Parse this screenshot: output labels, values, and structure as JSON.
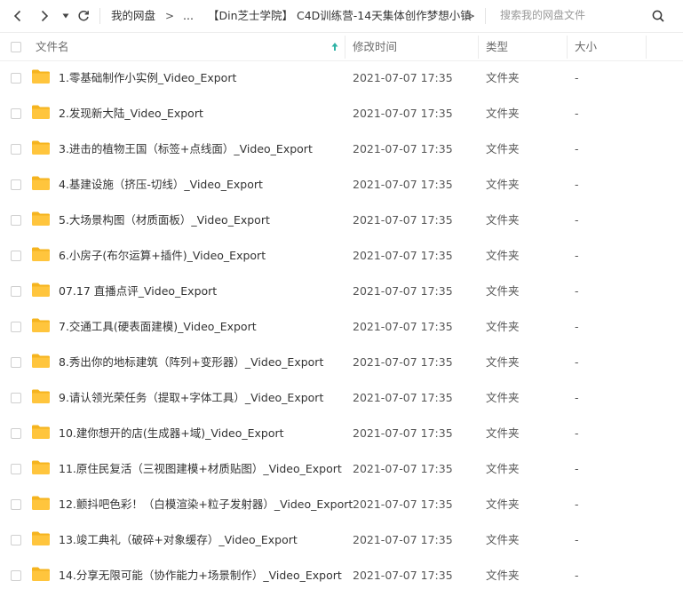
{
  "toolbar": {
    "back_icon": "chevron-left-icon",
    "forward_icon": "chevron-right-icon",
    "history_icon": "caret-down-icon",
    "refresh_icon": "refresh-icon",
    "breadcrumb": {
      "root": "我的网盘",
      "sep1": ">",
      "ellipsis": "...",
      "current": "【Din芝士学院】 C4D训练营-14天集体创作梦想小镇",
      "sep2": ">"
    },
    "search_placeholder": "搜索我的网盘文件",
    "search_icon": "search-icon"
  },
  "columns": {
    "name": "文件名",
    "sort_icon": "sort-ascending-icon",
    "modified": "修改时间",
    "type": "类型",
    "size": "大小"
  },
  "colors": {
    "folder": "#FFC53D",
    "folder_tab": "#F5B41F",
    "sort_arrow": "#2FB3A6"
  },
  "rows": [
    {
      "name": "1.零基础制作小实例_Video_Export",
      "modified": "2021-07-07 17:35",
      "type": "文件夹",
      "size": "-"
    },
    {
      "name": "2.发现新大陆_Video_Export",
      "modified": "2021-07-07 17:35",
      "type": "文件夹",
      "size": "-"
    },
    {
      "name": "3.进击的植物王国（标签+点线面）_Video_Export",
      "modified": "2021-07-07 17:35",
      "type": "文件夹",
      "size": "-"
    },
    {
      "name": "4.基建设施（挤压-切线）_Video_Export",
      "modified": "2021-07-07 17:35",
      "type": "文件夹",
      "size": "-"
    },
    {
      "name": "5.大场景构图（材质面板）_Video_Export",
      "modified": "2021-07-07 17:35",
      "type": "文件夹",
      "size": "-"
    },
    {
      "name": "6.小房子(布尔运算+插件)_Video_Export",
      "modified": "2021-07-07 17:35",
      "type": "文件夹",
      "size": "-"
    },
    {
      "name": "07.17 直播点评_Video_Export",
      "modified": "2021-07-07 17:35",
      "type": "文件夹",
      "size": "-"
    },
    {
      "name": "7.交通工具(硬表面建模)_Video_Export",
      "modified": "2021-07-07 17:35",
      "type": "文件夹",
      "size": "-"
    },
    {
      "name": "8.秀出你的地标建筑（阵列+变形器）_Video_Export",
      "modified": "2021-07-07 17:35",
      "type": "文件夹",
      "size": "-"
    },
    {
      "name": "9.请认领光荣任务（提取+字体工具）_Video_Export",
      "modified": "2021-07-07 17:35",
      "type": "文件夹",
      "size": "-"
    },
    {
      "name": "10.建你想开的店(生成器+域)_Video_Export",
      "modified": "2021-07-07 17:35",
      "type": "文件夹",
      "size": "-"
    },
    {
      "name": "11.原住民复活（三视图建模+材质贴图）_Video_Export",
      "modified": "2021-07-07 17:35",
      "type": "文件夹",
      "size": "-"
    },
    {
      "name": "12.颤抖吧色彩！（白模渲染+粒子发射器）_Video_Export",
      "modified": "2021-07-07 17:35",
      "type": "文件夹",
      "size": "-"
    },
    {
      "name": "13.竣工典礼（破碎+对象缓存）_Video_Export",
      "modified": "2021-07-07 17:35",
      "type": "文件夹",
      "size": "-"
    },
    {
      "name": "14.分享无限可能（协作能力+场景制作）_Video_Export",
      "modified": "2021-07-07 17:35",
      "type": "文件夹",
      "size": "-"
    }
  ]
}
